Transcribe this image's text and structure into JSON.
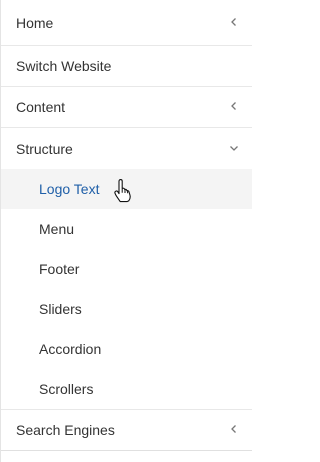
{
  "nav": {
    "items": [
      {
        "label": "Home",
        "chevron": "left"
      },
      {
        "label": "Switch Website"
      },
      {
        "label": "Content",
        "chevron": "left"
      },
      {
        "label": "Structure",
        "chevron": "down"
      }
    ],
    "sub_items": [
      {
        "label": "Logo Text",
        "active": true
      },
      {
        "label": "Menu"
      },
      {
        "label": "Footer"
      },
      {
        "label": "Sliders"
      },
      {
        "label": "Accordion"
      },
      {
        "label": "Scrollers"
      }
    ],
    "last_item": {
      "label": "Search Engines",
      "chevron": "left"
    }
  },
  "colors": {
    "active_text": "#1f5fa8",
    "active_bg": "#f4f4f4",
    "text": "#333333",
    "divider": "#e8e8e8"
  },
  "icons": {
    "chevron_left": "chevron-left-icon",
    "chevron_down": "chevron-down-icon",
    "cursor": "hand-pointer-icon"
  }
}
